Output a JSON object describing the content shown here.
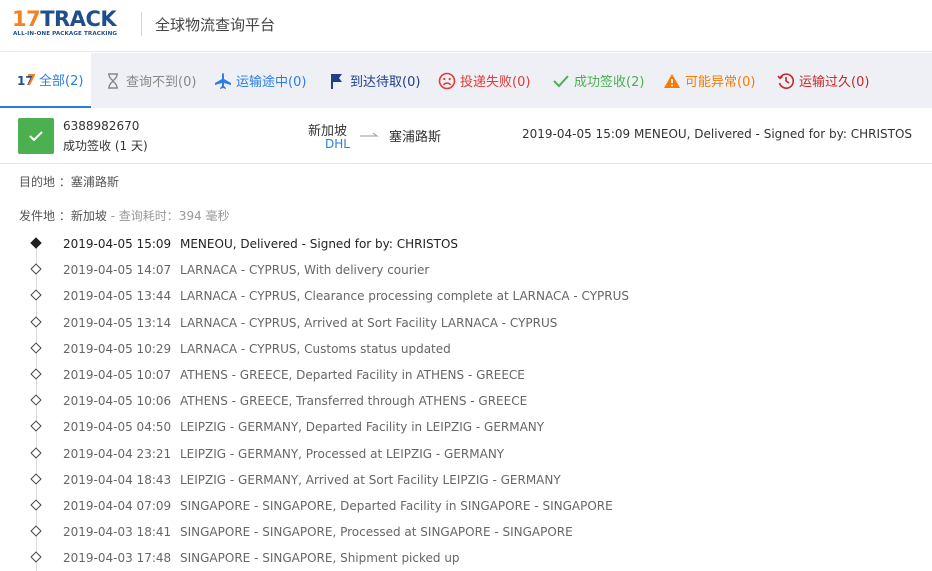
{
  "header": {
    "logo_num": "17",
    "logo_track": "TRACK",
    "logo_sub": "ALL-IN-ONE PACKAGE TRACKING",
    "title": "全球物流查询平台"
  },
  "tabs": [
    {
      "label": "全部(2)",
      "icon": "17track-logo-icon",
      "color": "#2a7de1",
      "active": true
    },
    {
      "label": "查询不到(0)",
      "icon": "hourglass-icon",
      "color": "#888888"
    },
    {
      "label": "运输途中(0)",
      "icon": "airplane-icon",
      "color": "#2a7de1"
    },
    {
      "label": "到达待取(0)",
      "icon": "flag-icon",
      "color": "#1f3f8c"
    },
    {
      "label": "投递失败(0)",
      "icon": "sad-face-icon",
      "color": "#e53935"
    },
    {
      "label": "成功签收(2)",
      "icon": "check-icon",
      "color": "#4caf50"
    },
    {
      "label": "可能异常(0)",
      "icon": "warning-icon",
      "color": "#f57c00"
    },
    {
      "label": "运输过久(0)",
      "icon": "clock-icon",
      "color": "#c62828"
    }
  ],
  "summary": {
    "tracking_number": "6388982670",
    "status": "成功签收 (1 天)",
    "origin": "新加坡",
    "carrier": "DHL",
    "destination": "塞浦路斯",
    "latest_event": "2019-04-05 15:09  MENEOU, Delivered - Signed for by: CHRISTOS",
    "status_color": "#4caf50"
  },
  "details": {
    "destination_label": "目的地 ：",
    "destination_value": "塞浦路斯",
    "origin_label": "发件地 ：",
    "origin_value": "新加坡",
    "query_time": " - 查询耗时：394 毫秒"
  },
  "events": [
    {
      "time": "2019-04-05 15:09",
      "desc": "MENEOU, Delivered - Signed for by: CHRISTOS"
    },
    {
      "time": "2019-04-05 14:07",
      "desc": "LARNACA - CYPRUS, With delivery courier"
    },
    {
      "time": "2019-04-05 13:44",
      "desc": "LARNACA - CYPRUS, Clearance processing complete at LARNACA - CYPRUS"
    },
    {
      "time": "2019-04-05 13:14",
      "desc": "LARNACA - CYPRUS, Arrived at Sort Facility LARNACA - CYPRUS"
    },
    {
      "time": "2019-04-05 10:29",
      "desc": "LARNACA - CYPRUS, Customs status updated"
    },
    {
      "time": "2019-04-05 10:07",
      "desc": "ATHENS - GREECE, Departed Facility in ATHENS - GREECE"
    },
    {
      "time": "2019-04-05 10:06",
      "desc": "ATHENS - GREECE, Transferred through ATHENS - GREECE"
    },
    {
      "time": "2019-04-05 04:50",
      "desc": "LEIPZIG - GERMANY, Departed Facility in LEIPZIG - GERMANY"
    },
    {
      "time": "2019-04-04 23:21",
      "desc": "LEIPZIG - GERMANY, Processed at LEIPZIG - GERMANY"
    },
    {
      "time": "2019-04-04 18:43",
      "desc": "LEIPZIG - GERMANY, Arrived at Sort Facility LEIPZIG - GERMANY"
    },
    {
      "time": "2019-04-04 07:09",
      "desc": "SINGAPORE - SINGAPORE, Departed Facility in SINGAPORE - SINGAPORE"
    },
    {
      "time": "2019-04-03 18:41",
      "desc": "SINGAPORE - SINGAPORE, Processed at SINGAPORE - SINGAPORE"
    },
    {
      "time": "2019-04-03 17:48",
      "desc": "SINGAPORE - SINGAPORE, Shipment picked up"
    }
  ]
}
